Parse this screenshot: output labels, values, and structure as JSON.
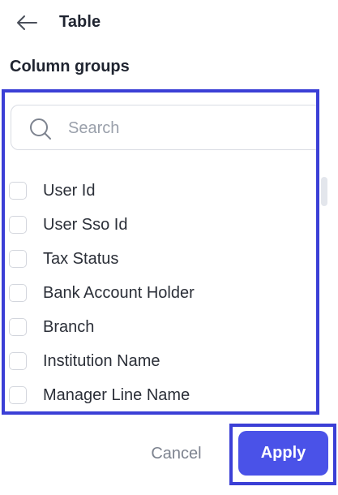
{
  "header": {
    "back_icon": "arrow-left-icon",
    "title": "Table"
  },
  "section": {
    "title": "Column groups"
  },
  "search": {
    "icon": "search-icon",
    "placeholder": "Search",
    "value": ""
  },
  "columns": [
    {
      "label": "User Id",
      "checked": false
    },
    {
      "label": "User Sso Id",
      "checked": false
    },
    {
      "label": "Tax Status",
      "checked": false
    },
    {
      "label": "Bank Account Holder",
      "checked": false
    },
    {
      "label": "Branch",
      "checked": false
    },
    {
      "label": "Institution Name",
      "checked": false
    },
    {
      "label": "Manager Line Name",
      "checked": false
    }
  ],
  "footer": {
    "cancel_label": "Cancel",
    "apply_label": "Apply"
  },
  "colors": {
    "accent": "#4a52e8",
    "highlight_border": "#3b3fd6"
  }
}
